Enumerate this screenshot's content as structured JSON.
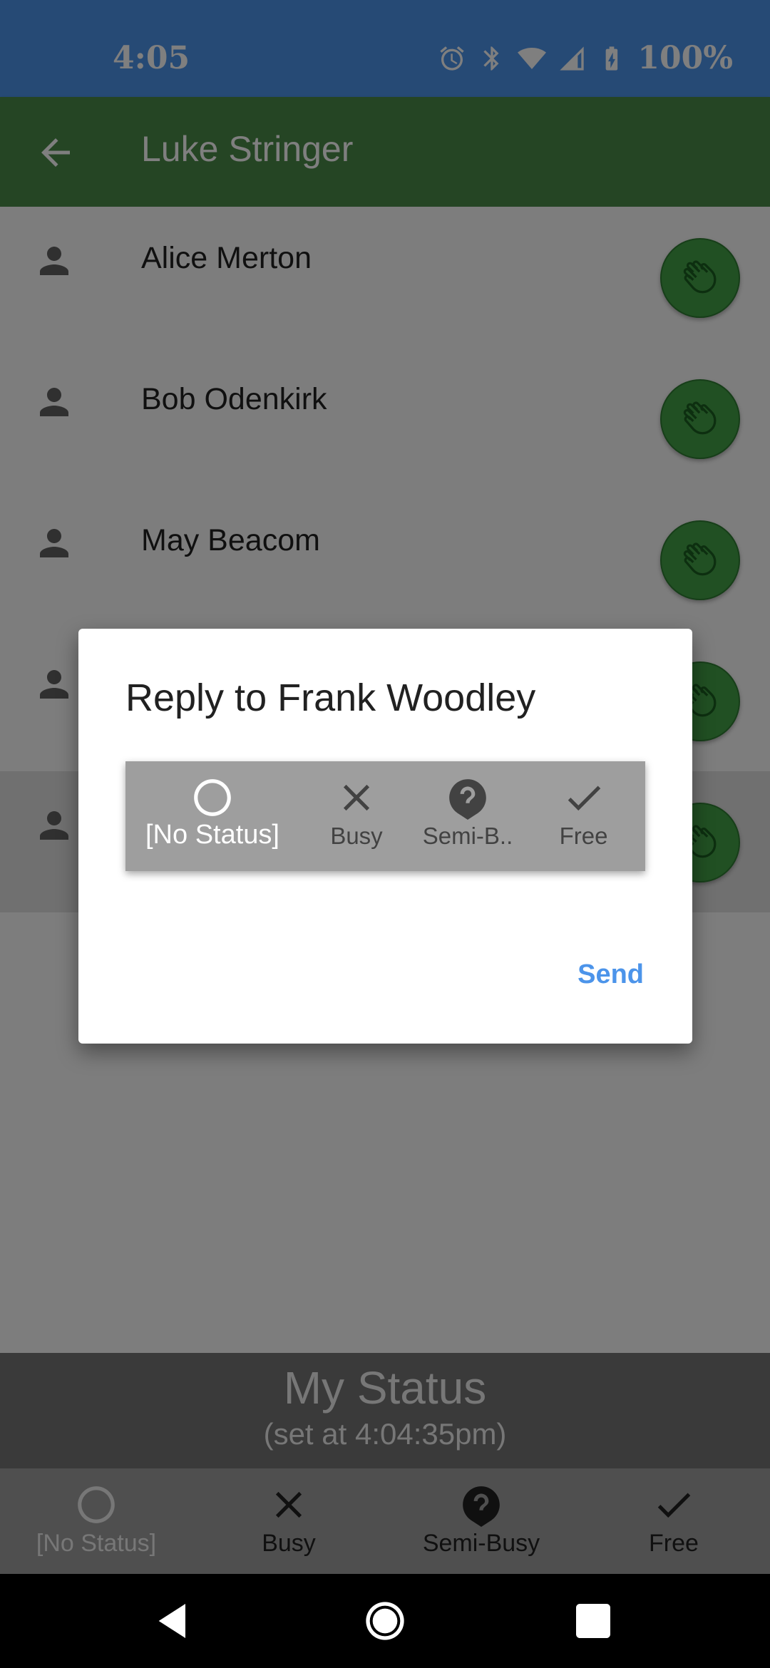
{
  "status_bar": {
    "time": "4:05",
    "battery": "100%"
  },
  "app_bar": {
    "title": "Luke Stringer"
  },
  "contacts": [
    {
      "name": "Alice Merton"
    },
    {
      "name": "Bob Odenkirk"
    },
    {
      "name": "May Beacom"
    },
    {
      "name": ""
    },
    {
      "name": ""
    }
  ],
  "my_status": {
    "title": "My Status",
    "subtitle": "(set at 4:04:35pm)"
  },
  "bottom_nav": {
    "items": [
      {
        "label": "[No Status]",
        "icon": "circle-outline-icon",
        "active": true
      },
      {
        "label": "Busy",
        "icon": "close-icon",
        "active": false
      },
      {
        "label": "Semi-Busy",
        "icon": "help-icon",
        "active": false
      },
      {
        "label": "Free",
        "icon": "check-icon",
        "active": false
      }
    ]
  },
  "dialog": {
    "title": "Reply to Frank Woodley",
    "options": [
      {
        "label": "[No Status]",
        "icon": "circle-outline-icon",
        "selected": true
      },
      {
        "label": "Busy",
        "icon": "close-icon",
        "selected": false
      },
      {
        "label": "Semi-B..",
        "icon": "help-icon",
        "selected": false
      },
      {
        "label": "Free",
        "icon": "check-icon",
        "selected": false
      }
    ],
    "send_label": "Send"
  },
  "colors": {
    "status_bar": "#4c94ea",
    "app_bar": "#4a8b49",
    "wave_button": "#43a047",
    "accent": "#4c94ea"
  }
}
